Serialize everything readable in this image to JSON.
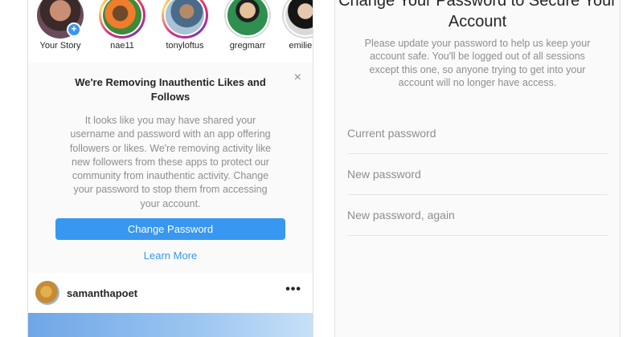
{
  "stories": [
    {
      "name": "Your Story",
      "ring": "none",
      "badge": "+"
    },
    {
      "name": "nae11",
      "ring": "active"
    },
    {
      "name": "tonyloftus",
      "ring": "active"
    },
    {
      "name": "gregmarr",
      "ring": "seen"
    },
    {
      "name": "emilie.ta",
      "ring": "seen"
    }
  ],
  "notice": {
    "close": "×",
    "title": "We're Removing Inauthentic Likes and Follows",
    "body": "It looks like you may have shared your username and password with an app offering followers or likes. We're removing activity like new followers from these apps to protect our community from inauthentic activity. Change your password to stop them from accessing your account.",
    "primary_button": "Change Password",
    "secondary_link": "Learn More"
  },
  "post": {
    "username": "samanthapoet",
    "more_icon": "•••"
  },
  "change_password": {
    "title": "Change Your Password to Secure Your Account",
    "subtitle": "Please update your password to help us keep your account safe. You'll be logged out of all sessions except this one, so anyone trying to get into your account will no longer have access.",
    "fields": {
      "current": "Current password",
      "new": "New password",
      "confirm": "New password, again"
    }
  },
  "colors": {
    "accent": "#3897f0",
    "text_primary": "#262626",
    "text_secondary": "#8e8e8e",
    "background": "#fafafa"
  }
}
